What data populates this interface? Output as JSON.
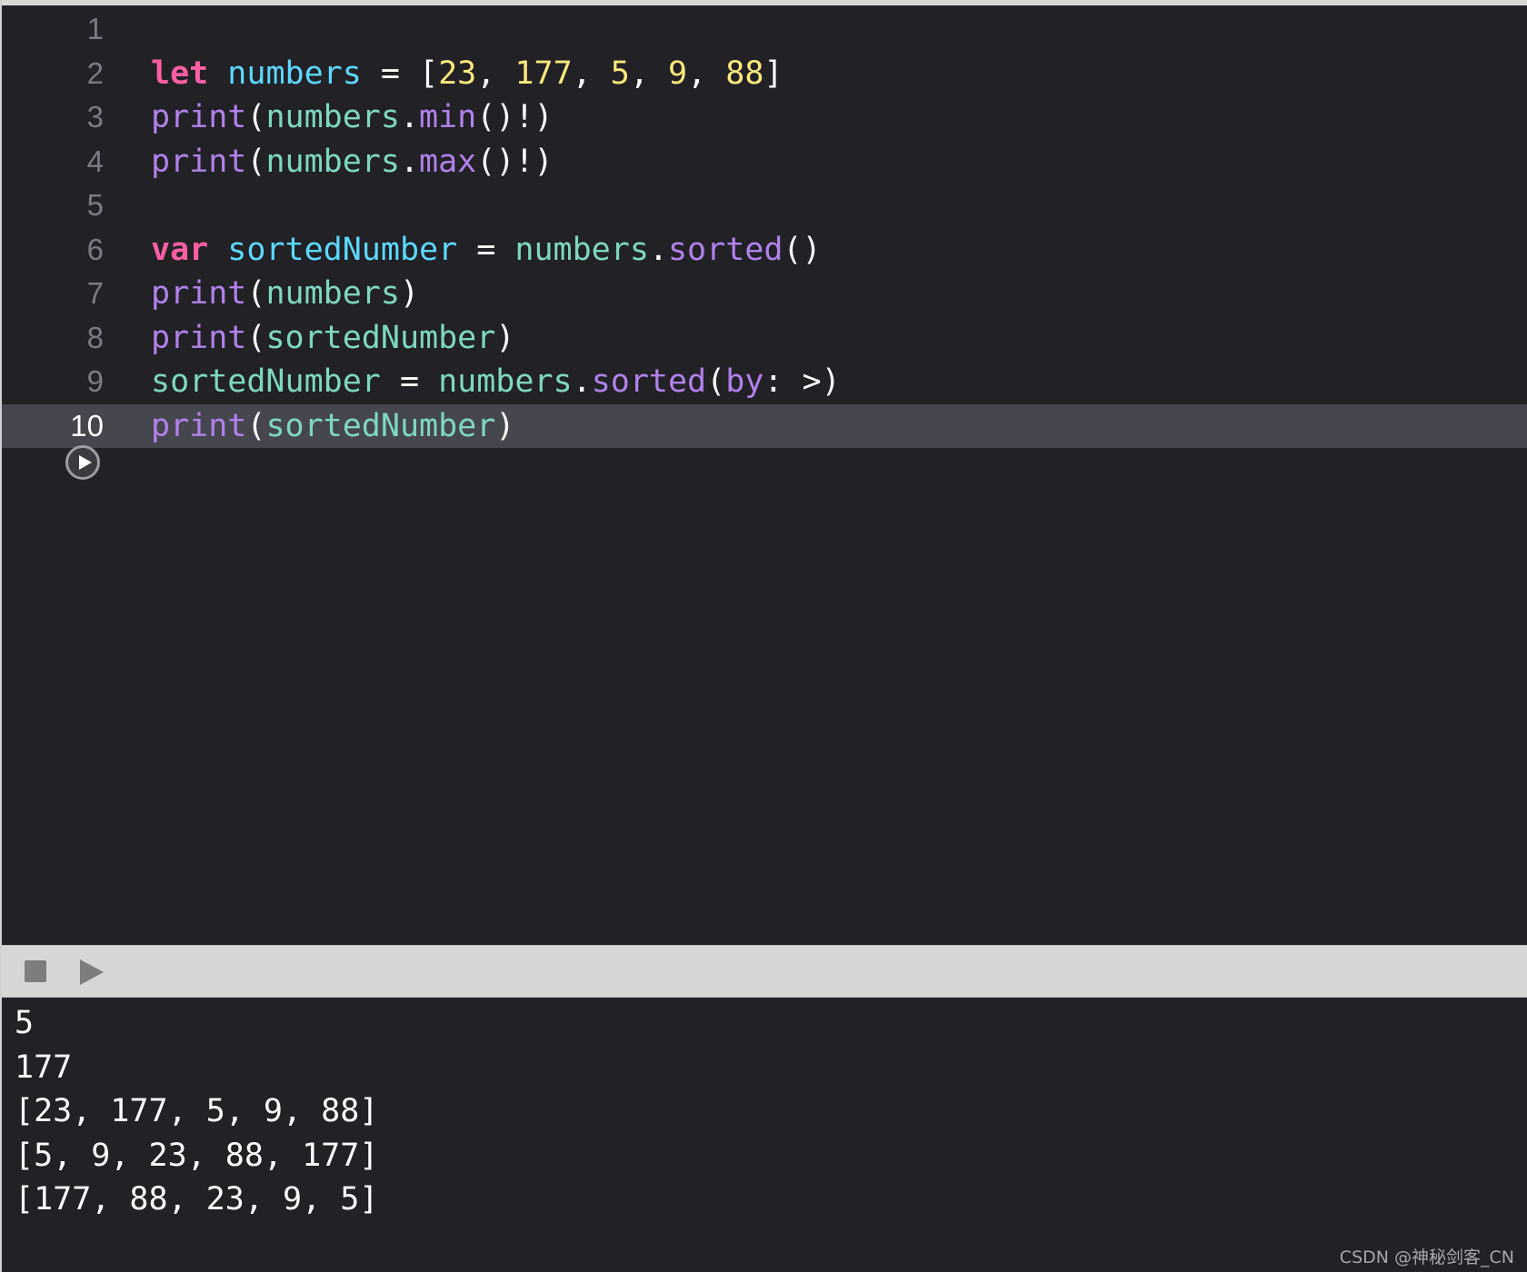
{
  "editor": {
    "lines": [
      {
        "num": "1",
        "tokens": []
      },
      {
        "num": "2",
        "tokens": [
          {
            "t": "let",
            "c": "kw"
          },
          {
            "t": " ",
            "c": "plain"
          },
          {
            "t": "numbers",
            "c": "decl"
          },
          {
            "t": " = [",
            "c": "plain"
          },
          {
            "t": "23",
            "c": "num"
          },
          {
            "t": ", ",
            "c": "plain"
          },
          {
            "t": "177",
            "c": "num"
          },
          {
            "t": ", ",
            "c": "plain"
          },
          {
            "t": "5",
            "c": "num"
          },
          {
            "t": ", ",
            "c": "plain"
          },
          {
            "t": "9",
            "c": "num"
          },
          {
            "t": ", ",
            "c": "plain"
          },
          {
            "t": "88",
            "c": "num"
          },
          {
            "t": "]",
            "c": "plain"
          }
        ]
      },
      {
        "num": "3",
        "tokens": [
          {
            "t": "print",
            "c": "fn"
          },
          {
            "t": "(",
            "c": "plain"
          },
          {
            "t": "numbers",
            "c": "var2"
          },
          {
            "t": ".",
            "c": "plain"
          },
          {
            "t": "min",
            "c": "fn"
          },
          {
            "t": "()!)",
            "c": "plain"
          }
        ]
      },
      {
        "num": "4",
        "tokens": [
          {
            "t": "print",
            "c": "fn"
          },
          {
            "t": "(",
            "c": "plain"
          },
          {
            "t": "numbers",
            "c": "var2"
          },
          {
            "t": ".",
            "c": "plain"
          },
          {
            "t": "max",
            "c": "fn"
          },
          {
            "t": "()!)",
            "c": "plain"
          }
        ]
      },
      {
        "num": "5",
        "tokens": []
      },
      {
        "num": "6",
        "tokens": [
          {
            "t": "var",
            "c": "kw"
          },
          {
            "t": " ",
            "c": "plain"
          },
          {
            "t": "sortedNumber",
            "c": "decl"
          },
          {
            "t": " = ",
            "c": "plain"
          },
          {
            "t": "numbers",
            "c": "var2"
          },
          {
            "t": ".",
            "c": "plain"
          },
          {
            "t": "sorted",
            "c": "fn"
          },
          {
            "t": "()",
            "c": "plain"
          }
        ]
      },
      {
        "num": "7",
        "tokens": [
          {
            "t": "print",
            "c": "fn"
          },
          {
            "t": "(",
            "c": "plain"
          },
          {
            "t": "numbers",
            "c": "var2"
          },
          {
            "t": ")",
            "c": "plain"
          }
        ]
      },
      {
        "num": "8",
        "tokens": [
          {
            "t": "print",
            "c": "fn"
          },
          {
            "t": "(",
            "c": "plain"
          },
          {
            "t": "sortedNumber",
            "c": "var2"
          },
          {
            "t": ")",
            "c": "plain"
          }
        ]
      },
      {
        "num": "9",
        "tokens": [
          {
            "t": "sortedNumber",
            "c": "var2"
          },
          {
            "t": " = ",
            "c": "plain"
          },
          {
            "t": "numbers",
            "c": "var2"
          },
          {
            "t": ".",
            "c": "plain"
          },
          {
            "t": "sorted",
            "c": "fn"
          },
          {
            "t": "(",
            "c": "plain"
          },
          {
            "t": "by",
            "c": "fn"
          },
          {
            "t": ": >)",
            "c": "plain"
          }
        ]
      },
      {
        "num": "10",
        "current": true,
        "tokens": [
          {
            "t": "print",
            "c": "fn"
          },
          {
            "t": "(",
            "c": "plain"
          },
          {
            "t": "sortedNumber",
            "c": "var2"
          },
          {
            "t": ")",
            "c": "plain"
          }
        ]
      }
    ],
    "run_button_icon": "play-circle-icon"
  },
  "debug_bar": {
    "stop_icon": "stop-icon",
    "play_icon": "play-icon"
  },
  "console": {
    "output": [
      "5",
      "177",
      "[23, 177, 5, 9, 88]",
      "[5, 9, 23, 88, 177]",
      "[177, 88, 23, 9, 5]"
    ]
  },
  "watermark": "CSDN @神秘剑客_CN"
}
